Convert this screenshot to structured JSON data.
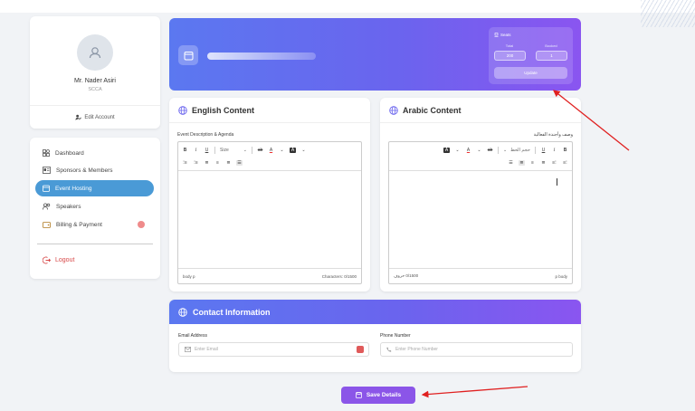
{
  "profile": {
    "name": "Mr. Nader Asiri",
    "org": "SCCA",
    "edit_label": "Edit Account"
  },
  "sidebar": {
    "items": [
      {
        "label": "Dashboard",
        "icon": "grid-icon",
        "active": false
      },
      {
        "label": "Sponsors & Members",
        "icon": "id-card-icon",
        "active": false
      },
      {
        "label": "Event Hosting",
        "icon": "calendar-icon",
        "active": true
      },
      {
        "label": "Speakers",
        "icon": "users-icon",
        "active": false
      },
      {
        "label": "Billing & Payment",
        "icon": "wallet-icon",
        "active": false
      }
    ],
    "logout_label": "Logout"
  },
  "seats": {
    "title": "Seats",
    "total_label": "Total",
    "booked_label": "Booked",
    "total_value": "200",
    "booked_value": "1",
    "update_label": "Update"
  },
  "english": {
    "title": "English Content",
    "field_label": "Event Description & Agenda",
    "toolbar": {
      "size_label": "Size",
      "status_path": "body  p",
      "char_count": "Characters: 0/1500"
    }
  },
  "arabic": {
    "title": "Arabic Content",
    "field_label": "وصف وأجندة الفعالية",
    "toolbar": {
      "size_label": "حجم الخط",
      "char_count": "0/1500 حروف",
      "status_path": "p  body"
    }
  },
  "contact": {
    "title": "Contact Information",
    "email_label": "Email Address",
    "email_placeholder": "Enter Email",
    "phone_label": "Phone Number",
    "phone_placeholder": "Enter Phone Number"
  },
  "save_label": "Save Details",
  "colors": {
    "accent": "#6a64ee",
    "active_nav": "#4a9ad6",
    "save": "#8b55e8",
    "logout": "#d84a4a"
  }
}
